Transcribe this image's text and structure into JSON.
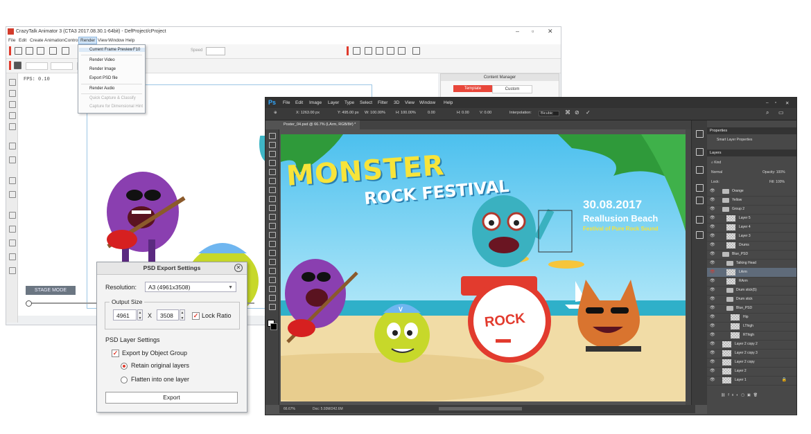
{
  "cta": {
    "title": "CrazyTalk Animator 3  (CTA3 2017.08.30.1-64bit) - DefProject/cProject",
    "win_controls": [
      "–",
      "▫",
      "✕"
    ],
    "menu": [
      "File",
      "Edit",
      "Create",
      "Animation",
      "Control",
      "Render",
      "View",
      "Window",
      "Help"
    ],
    "speed_label": "Speed",
    "fps_label": "FPS: 0.10",
    "stage_mode": "STAGE MODE",
    "content_manager": {
      "title": "Content Manager",
      "tab_active": "Template",
      "tab_other": "Custom"
    }
  },
  "render_menu": {
    "items": [
      {
        "label": "Current Frame Preview",
        "shortcut": "F10"
      },
      {
        "label": "Render Video",
        "shortcut": ""
      },
      {
        "label": "Render Image",
        "shortcut": ""
      },
      {
        "label": "Export PSD file",
        "shortcut": ""
      },
      {
        "label": "Render Audio",
        "shortcut": ""
      },
      {
        "label": "Quick Capture & Classify",
        "shortcut": ""
      },
      {
        "label": "Capture for Dimensional Hint",
        "shortcut": ""
      }
    ]
  },
  "psd_dialog": {
    "title": "PSD Export Settings",
    "resolution_label": "Resolution:",
    "resolution_value": "A3 (4961x3508)",
    "output_size_label": "Output Size",
    "width": "4961",
    "x_label": "X",
    "height": "3508",
    "lock_ratio": "Lock Ratio",
    "layer_settings_label": "PSD Layer Settings",
    "export_by_group": "Export by Object Group",
    "retain_layers": "Retain original layers",
    "flatten_layer": "Flatten into one layer",
    "export_button": "Export"
  },
  "ps": {
    "logo": "Ps",
    "menu": [
      "File",
      "Edit",
      "Image",
      "Layer",
      "Type",
      "Select",
      "Filter",
      "3D",
      "View",
      "Window",
      "Help"
    ],
    "options": {
      "x": "X: 1263.00 px",
      "y": "Y: 495.00 px",
      "w": "W: 100.00%",
      "h": "H: 100.00%",
      "angle": "0.00",
      "hskew": "H: 0.00",
      "vskew": "V: 0.00",
      "interp_label": "Interpolation:",
      "interp": "Bicubic"
    },
    "doc_tab": "Poster_04.psd @ 66.7% (LArm, RGB/8#) *",
    "status_zoom": "66.67%",
    "status_doc": "Doc: 5.93M/242.6M",
    "poster": {
      "title1": "MONSTER",
      "title2": "ROCK FESTIVAL",
      "date": "30.08.2017",
      "place": "Reallusion Beach",
      "tagline": "Festival of Pure Rock Sound",
      "drum_text": "ROCK",
      "cap_letter": "V"
    },
    "panels": {
      "properties": "Properties",
      "props_sub": "Smart Layer Properties",
      "layers": "Layers",
      "kind": "Kind",
      "blend": "Normal",
      "opacity": "Opacity: 100%",
      "lock": "Lock:",
      "fill": "Fill: 100%"
    },
    "layers": [
      {
        "name": "Orange",
        "type": "folder",
        "indent": 1,
        "selected": false
      },
      {
        "name": "Yellow",
        "type": "folder",
        "indent": 1,
        "selected": false
      },
      {
        "name": "Group 2",
        "type": "folder",
        "indent": 1,
        "selected": false
      },
      {
        "name": "Layer 5",
        "type": "layer",
        "indent": 2,
        "selected": false
      },
      {
        "name": "Layer 4",
        "type": "layer",
        "indent": 2,
        "selected": false
      },
      {
        "name": "Layer 3",
        "type": "layer",
        "indent": 2,
        "selected": false
      },
      {
        "name": "Drums",
        "type": "layer",
        "indent": 2,
        "selected": false
      },
      {
        "name": "Blue_PSD",
        "type": "folder",
        "indent": 1,
        "selected": false
      },
      {
        "name": "Talking Head",
        "type": "folder",
        "indent": 2,
        "selected": false
      },
      {
        "name": "LArm",
        "type": "layer",
        "indent": 2,
        "selected": true
      },
      {
        "name": "RArm",
        "type": "layer",
        "indent": 2,
        "selected": false
      },
      {
        "name": "Drum stick(5)",
        "type": "folder",
        "indent": 2,
        "selected": false
      },
      {
        "name": "Drum stick",
        "type": "folder",
        "indent": 2,
        "selected": false
      },
      {
        "name": "Blue_PSD",
        "type": "folder",
        "indent": 2,
        "selected": false
      },
      {
        "name": "Hip",
        "type": "layer",
        "indent": 3,
        "selected": false
      },
      {
        "name": "LThigh",
        "type": "layer",
        "indent": 3,
        "selected": false
      },
      {
        "name": "RThigh",
        "type": "layer",
        "indent": 3,
        "selected": false
      },
      {
        "name": "Layer 2 copy 2",
        "type": "layer",
        "indent": 1,
        "selected": false
      },
      {
        "name": "Layer 2 copy 3",
        "type": "layer",
        "indent": 1,
        "selected": false
      },
      {
        "name": "Layer 2 copy",
        "type": "layer",
        "indent": 1,
        "selected": false
      },
      {
        "name": "Layer 2",
        "type": "layer",
        "indent": 1,
        "selected": false
      },
      {
        "name": "Layer 1",
        "type": "layer",
        "indent": 1,
        "selected": false
      }
    ]
  },
  "colors": {
    "accent_red": "#e03a2c",
    "ps_blue": "#31a8ff",
    "sky": "#56c6ee",
    "poster_yellow": "#f7e43a"
  }
}
